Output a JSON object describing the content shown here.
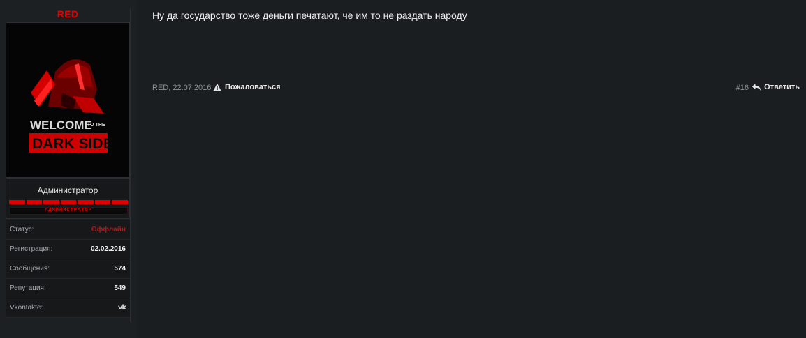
{
  "user": {
    "name": "RED",
    "avatar_text_line1": "WELCOME",
    "avatar_text_to": "TO THE",
    "avatar_text_line2": "DARK SIDE",
    "title": "Администратор",
    "rank_banner": "АДМИНИСТРАТОР",
    "rank_bar_count": 7,
    "info": [
      {
        "label": "Статус:",
        "value": "Оффлайн"
      },
      {
        "label": "Регистрация:",
        "value": "02.02.2016"
      },
      {
        "label": "Сообщения:",
        "value": "574"
      },
      {
        "label": "Репутация:",
        "value": "549"
      },
      {
        "label": "Vkontakte:",
        "value": ""
      }
    ]
  },
  "post": {
    "text": "Ну да государство тоже деньги печатают, че им то не раздать народу",
    "author_date": "RED, 22.07.2016",
    "report_label": "Пожаловаться",
    "number": "#16",
    "reply_label": "Ответить"
  },
  "colors": {
    "background": "#1b1e21",
    "accent_red": "#e60000",
    "offline_red": "#b01818"
  },
  "icons": {
    "warning": "warning-triangle-icon",
    "reply": "reply-arrow-icon",
    "vk": "vk-icon"
  }
}
